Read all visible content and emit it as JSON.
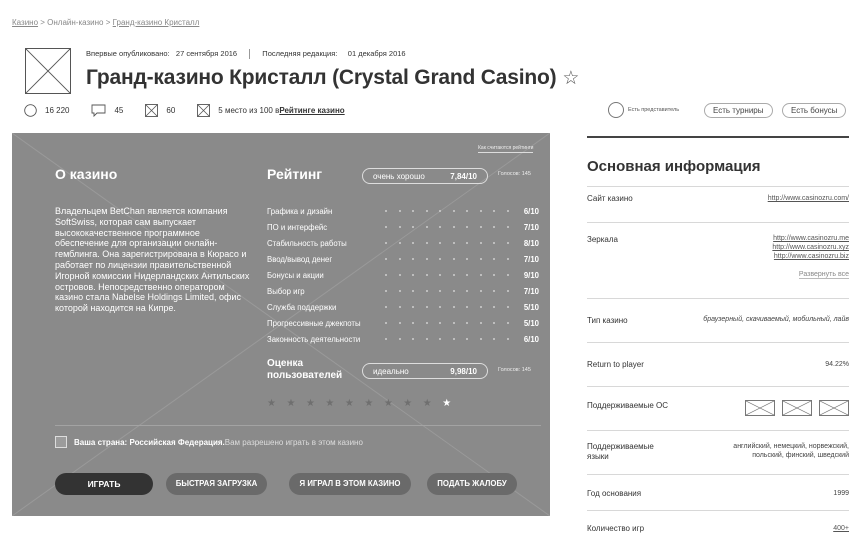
{
  "breadcrumb": {
    "home": "Казино",
    "sep1": " > ",
    "section": "Онлайн-казино",
    "sep2": " > ",
    "current": "Гранд-казино Кристалл"
  },
  "meta": {
    "first_label": "Впервые опубликовано:",
    "first_date": "27 сентября 2016",
    "last_label": "Последняя редакция:",
    "last_date": "01 декабря 2016"
  },
  "title": "Гранд-казино Кристалл (Crystal Grand Casino)",
  "title_star": "☆",
  "stats": {
    "views": "16 220",
    "comments": "45",
    "third": "60",
    "place_prefix": "5 место из 100 в ",
    "place_link": "Рейтинге казино"
  },
  "representative": "Есть представитель",
  "badges": [
    "Есть турниры",
    "Есть бонусы"
  ],
  "panel": {
    "how_link": "Как считаются рейтинги",
    "about_heading": "О казино",
    "description": "Владельцем BetChan является компания SoftSwiss, которая сам выпускает высококачественное программное обеспечение для организации онлайн-гемблинга. Она зарегистрирована в Кюрасо и работает по лицензии правительственной Игорной комиссии Нидерландских Антильских островов. Непосредственно оператором казино стала Nabelse Holdings Limited, офис которой находится на Кипре.",
    "rating_heading": "Рейтинг",
    "rating_label": "очень хорошо",
    "rating_value": "7,84/10",
    "rating_votes": "Голосов: 145",
    "criteria": [
      {
        "name": "Графика и дизайн",
        "value": "6/10"
      },
      {
        "name": "ПО и интерфейс",
        "value": "7/10"
      },
      {
        "name": "Стабильность работы",
        "value": "8/10"
      },
      {
        "name": "Ввод/вывод денег",
        "value": "7/10"
      },
      {
        "name": "Бонусы и акции",
        "value": "9/10"
      },
      {
        "name": "Выбор игр",
        "value": "7/10"
      },
      {
        "name": "Служба поддержки",
        "value": "5/10"
      },
      {
        "name": "Прогрессивные джекпоты",
        "value": "5/10"
      },
      {
        "name": "Законность деятельности",
        "value": "6/10"
      }
    ],
    "user_heading_1": "Оценка",
    "user_heading_2": "пользователей",
    "user_label": "идеально",
    "user_value": "9,98/10",
    "user_votes": "Голосов: 145",
    "user_stars_filled": 1,
    "user_stars_total": 10,
    "country_label": "Ваша страна: Российская Федерация.",
    "country_rest": " Вам разрешено играть в этом казино",
    "buttons": {
      "play": "ИГРАТЬ",
      "fast": "БЫСТРАЯ ЗАГРУЗКА",
      "played": "Я ИГРАЛ В ЭТОМ КАЗИНО",
      "complaint": "ПОДАТЬ ЖАЛОБУ"
    }
  },
  "info": {
    "heading": "Основная информация",
    "site_label": "Сайт казино",
    "site_value": "http://www.casinozru.com/",
    "mirrors_label": "Зеркала",
    "mirrors": [
      "http://www.casinozru.me",
      "http://www.casinozru.xyz",
      "http://www.casinozru.biz"
    ],
    "expand_link": "Развернуть все",
    "type_label": "Тип казино",
    "type_value": "браузерный, скачиваемый, мобильный, лайв",
    "rtp_label": "Return to player",
    "rtp_value": "94.22%",
    "os_label": "Поддерживаемые ОС",
    "lang_label_1": "Поддерживаемые",
    "lang_label_2": "языки",
    "lang_value_1": "английский, немецкий, норвежский,",
    "lang_value_2": "польский, финский, шведский",
    "year_label": "Год основания",
    "year_value": "1999",
    "games_label": "Количество игр",
    "games_value": "400+"
  },
  "colors": {
    "panel_bg": "#8a8a8a",
    "primary_button": "#333333",
    "secondary_button": "#6a6a6a"
  }
}
